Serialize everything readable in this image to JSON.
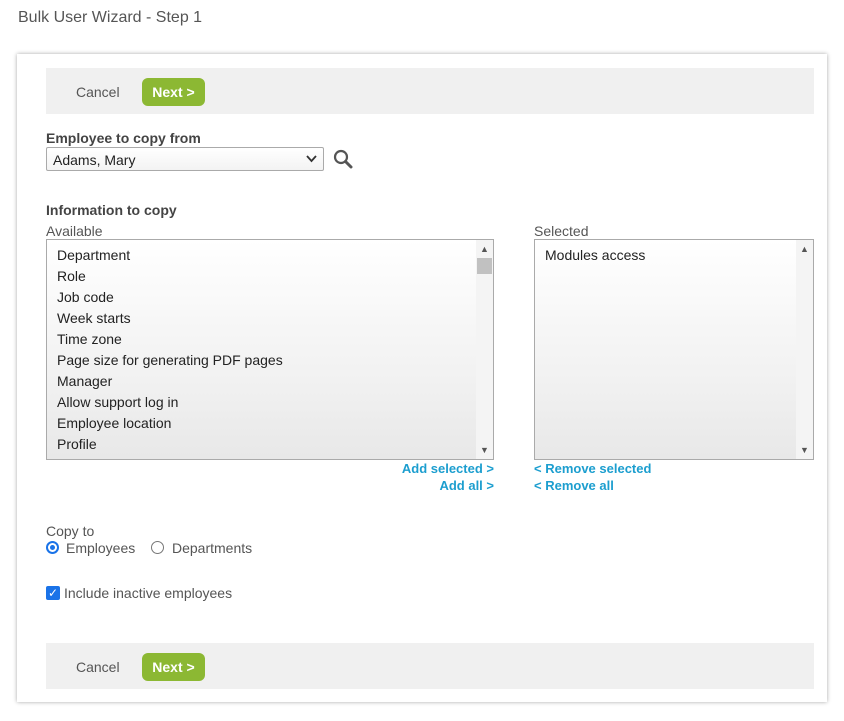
{
  "page": {
    "title": "Bulk User Wizard - Step 1"
  },
  "toolbar": {
    "cancel_label": "Cancel",
    "next_label": "Next >"
  },
  "employee_copy": {
    "label": "Employee to copy from",
    "selected": "Adams, Mary",
    "search_icon": "search-icon"
  },
  "information": {
    "label": "Information to copy",
    "available_label": "Available",
    "selected_label": "Selected",
    "available_items": [
      "Department",
      "Role",
      "Job code",
      "Week starts",
      "Time zone",
      "Page size for generating PDF pages",
      "Manager",
      "Allow support log in",
      "Employee location",
      "Profile"
    ],
    "selected_items": [
      "Modules access"
    ],
    "add_selected": "Add selected >",
    "add_all": "Add all >",
    "remove_selected": "< Remove selected",
    "remove_all": "< Remove all"
  },
  "copy_to": {
    "label": "Copy to",
    "option_employees": "Employees",
    "option_departments": "Departments",
    "selected": "Employees"
  },
  "include_inactive": {
    "label": "Include inactive employees",
    "checked": true
  },
  "colors": {
    "accent_green": "#8cb833",
    "link_blue": "#1c9ecf",
    "control_blue": "#1a73e8"
  }
}
